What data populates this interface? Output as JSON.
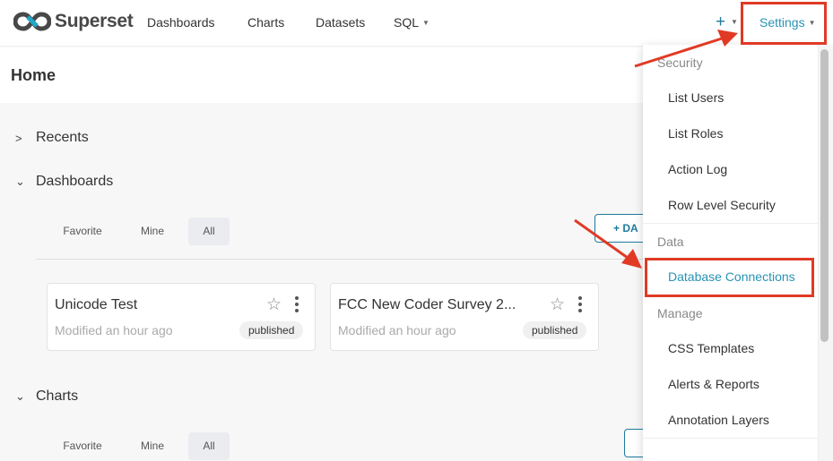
{
  "navbar": {
    "brand": "Superset",
    "items": [
      {
        "label": "Dashboards"
      },
      {
        "label": "Charts"
      },
      {
        "label": "Datasets"
      },
      {
        "label": "SQL",
        "has_caret": true
      }
    ],
    "plus_icon": "plus-icon",
    "settings_label": "Settings"
  },
  "page": {
    "title": "Home"
  },
  "sections": {
    "recents": {
      "label": "Recents",
      "expanded": false
    },
    "dashboards": {
      "label": "Dashboards",
      "expanded": true,
      "tabs": [
        "Favorite",
        "Mine",
        "All"
      ],
      "active_tab": "All",
      "add_button_label": "+ DA",
      "cards": [
        {
          "title": "Unicode Test",
          "modified": "Modified an hour ago",
          "status": "published"
        },
        {
          "title": "FCC New Coder Survey 2...",
          "modified": "Modified an hour ago",
          "status": "published"
        }
      ]
    },
    "charts": {
      "label": "Charts",
      "expanded": true,
      "tabs": [
        "Favorite",
        "Mine",
        "All"
      ],
      "active_tab": "All"
    }
  },
  "settings_menu": {
    "groups": [
      {
        "label": "Security",
        "items": [
          "List Users",
          "List Roles",
          "Action Log",
          "Row Level Security"
        ]
      },
      {
        "label": "Data",
        "items": [
          "Database Connections"
        ]
      },
      {
        "label": "Manage",
        "items": [
          "CSS Templates",
          "Alerts & Reports",
          "Annotation Layers"
        ]
      }
    ],
    "selected_item": "Database Connections"
  },
  "annotations": {
    "highlight_color": "#e03a25"
  }
}
